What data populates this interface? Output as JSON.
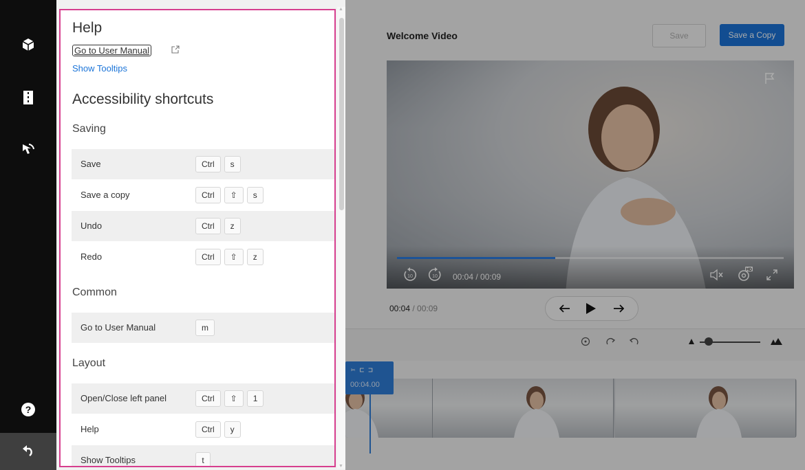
{
  "rail": {
    "icons": [
      "cube-icon",
      "film-icon",
      "cursor-icon",
      "help-icon",
      "undo-icon"
    ]
  },
  "editor": {
    "title": "Welcome Video",
    "save_label": "Save",
    "save_copy_label": "Save a Copy",
    "player": {
      "time_display": "00:04 / 00:09",
      "progress": 0.41
    },
    "current_time": "00:04",
    "total_time": "/ 00:09",
    "playhead_time": "00:04.00"
  },
  "help": {
    "title": "Help",
    "manual_link": "Go to User Manual",
    "tooltips_link": "Show Tooltips",
    "shortcuts_title": "Accessibility shortcuts",
    "sections": [
      {
        "title": "Saving",
        "rows": [
          {
            "label": "Save",
            "keys": [
              "Ctrl",
              "s"
            ]
          },
          {
            "label": "Save a copy",
            "keys": [
              "Ctrl",
              "⇧",
              "s"
            ]
          },
          {
            "label": "Undo",
            "keys": [
              "Ctrl",
              "z"
            ]
          },
          {
            "label": "Redo",
            "keys": [
              "Ctrl",
              "⇧",
              "z"
            ]
          }
        ]
      },
      {
        "title": "Common",
        "rows": [
          {
            "label": "Go to User Manual",
            "keys": [
              "m"
            ]
          }
        ]
      },
      {
        "title": "Layout",
        "rows": [
          {
            "label": "Open/Close left panel",
            "keys": [
              "Ctrl",
              "⇧",
              "1"
            ]
          },
          {
            "label": "Help",
            "keys": [
              "Ctrl",
              "y"
            ]
          },
          {
            "label": "Show Tooltips",
            "keys": [
              "t"
            ]
          }
        ]
      }
    ]
  },
  "colors": {
    "accent": "#1b74d8",
    "panel_border": "#d63e8e",
    "rail": "#0d0d0d"
  }
}
